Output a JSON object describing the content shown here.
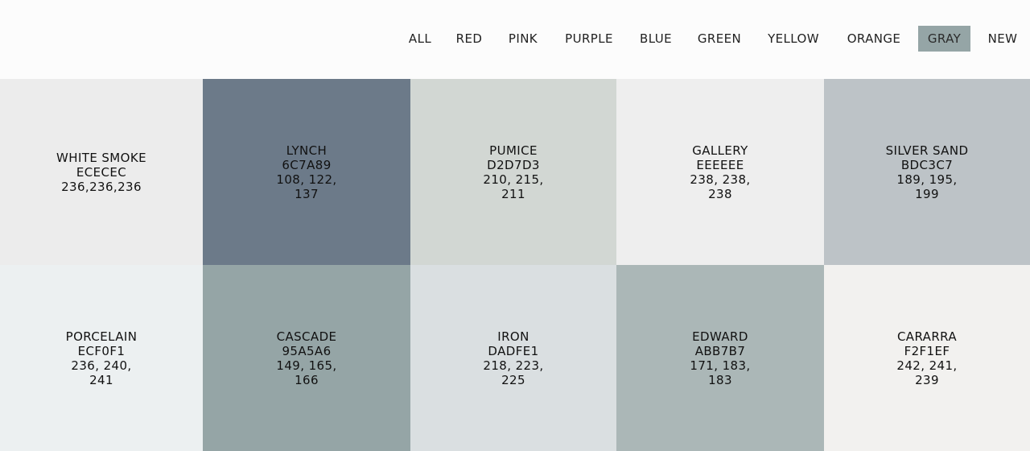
{
  "nav": {
    "items": [
      {
        "label": "ALL"
      },
      {
        "label": "RED"
      },
      {
        "label": "PINK"
      },
      {
        "label": "PURPLE"
      },
      {
        "label": "BLUE"
      },
      {
        "label": "GREEN"
      },
      {
        "label": "YELLOW"
      },
      {
        "label": "ORANGE"
      },
      {
        "label": "GRAY",
        "active": true
      },
      {
        "label": "NEW"
      }
    ],
    "active_color": "#95a5a6"
  },
  "swatches": [
    {
      "name": "WHITE SMOKE",
      "hex": "ECECEC",
      "rgb": "236,236,236",
      "color": "#ececec"
    },
    {
      "name": "LYNCH",
      "hex": "6C7A89",
      "rgb": "108, 122, 137",
      "color": "#6c7a89"
    },
    {
      "name": "PUMICE",
      "hex": "D2D7D3",
      "rgb": "210, 215, 211",
      "color": "#d2d7d3"
    },
    {
      "name": "GALLERY",
      "hex": "EEEEEE",
      "rgb": "238, 238, 238",
      "color": "#eeeeee"
    },
    {
      "name": "SILVER SAND",
      "hex": "BDC3C7",
      "rgb": "189, 195, 199",
      "color": "#bdc3c7"
    },
    {
      "name": "PORCELAIN",
      "hex": "ECF0F1",
      "rgb": "236, 240, 241",
      "color": "#ecf0f1"
    },
    {
      "name": "CASCADE",
      "hex": "95A5A6",
      "rgb": "149, 165, 166",
      "color": "#95a5a6"
    },
    {
      "name": "IRON",
      "hex": "DADFE1",
      "rgb": "218, 223, 225",
      "color": "#dadfe1"
    },
    {
      "name": "EDWARD",
      "hex": "ABB7B7",
      "rgb": "171, 183, 183",
      "color": "#abb7b7"
    },
    {
      "name": "CARARRA",
      "hex": "F2F1EF",
      "rgb": "242, 241, 239",
      "color": "#f2f1ef"
    }
  ]
}
